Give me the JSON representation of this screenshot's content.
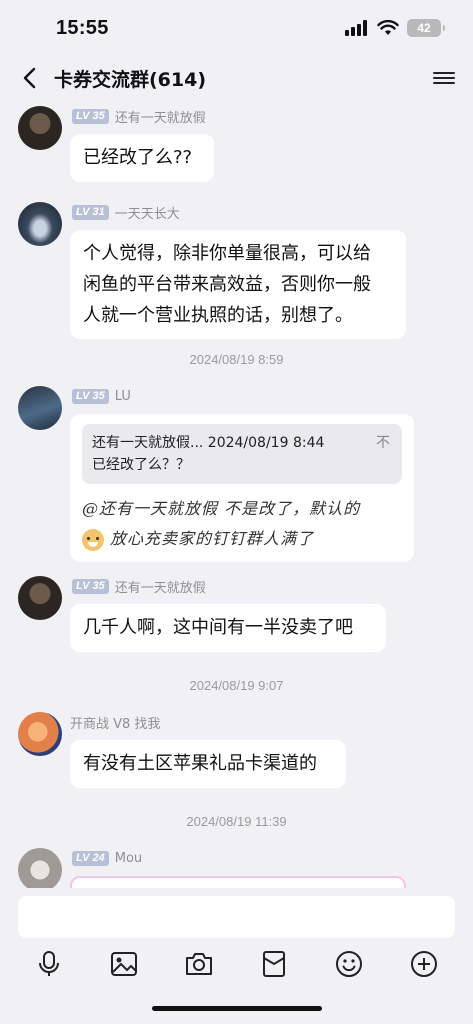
{
  "status": {
    "time": "15:55",
    "battery": "42"
  },
  "header": {
    "title": "卡券交流群(614)"
  },
  "messages": [
    {
      "level": "LV 35",
      "nick": "还有一天就放假",
      "text": "已经改了么??"
    },
    {
      "level": "LV 31",
      "nick": "一天天长大",
      "lines": [
        "个人觉得，除非你单量很高，可以给",
        "闲鱼的平台带来高效益，否则你一般",
        "人就一个营业执照的话，别想了。"
      ]
    },
    {
      "level": "LV 35",
      "nick": "LU",
      "quote_header": "还有一天就放假... 2024/08/19 8:44",
      "quote_text": "已经改了么？？",
      "quote_close": "不",
      "reply_line1": "@还有一天就放假 不是改了，默认的",
      "reply_line2": "放心充卖家的钉钉群人满了"
    },
    {
      "level": "LV 35",
      "nick": "还有一天就放假",
      "text": "几千人啊，这中间有一半没卖了吧"
    },
    {
      "level": "",
      "nick": "开商战 V8 找我",
      "text": "有没有土区苹果礼品卡渠道的"
    },
    {
      "level": "LV 24",
      "nick": "Mou"
    }
  ],
  "timestamps": [
    "2024/08/19 8:59",
    "2024/08/19 9:07",
    "2024/08/19 11:39"
  ],
  "toolbar": [
    "microphone-icon",
    "image-icon",
    "camera-icon",
    "red-packet-icon",
    "emoji-icon",
    "plus-icon"
  ]
}
